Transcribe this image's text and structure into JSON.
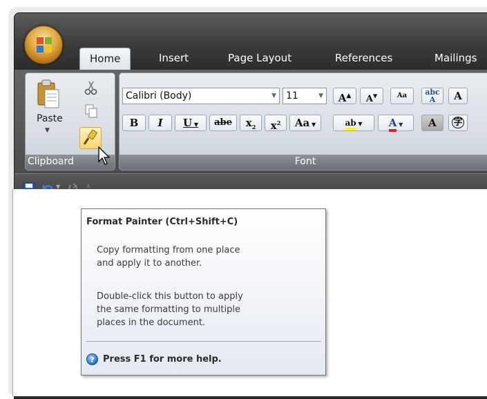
{
  "ribbon": {
    "tabs": [
      {
        "label": "Home"
      },
      {
        "label": "Insert"
      },
      {
        "label": "Page Layout"
      },
      {
        "label": "References"
      },
      {
        "label": "Mailings"
      }
    ],
    "clipboard": {
      "paste_label": "Paste",
      "group_label": "Clipboard"
    },
    "font": {
      "font_name": "Calibri (Body)",
      "font_size": "11",
      "group_label": "Font",
      "bold": "B",
      "italic": "I",
      "underline": "U",
      "strike": "abe",
      "subscript": "x",
      "superscript": "x",
      "change_case": "Aa",
      "highlight": "ab",
      "font_color": "A",
      "char_shading": "A",
      "enclose": "字"
    }
  },
  "tooltip": {
    "title": "Format Painter (Ctrl+Shift+C)",
    "line1": "Copy formatting from one place",
    "line2": "and apply it to another.",
    "line3": "Double-click this button to apply",
    "line4": "the same formatting to multiple",
    "line5": "places in the document.",
    "help": "Press F1 for more help."
  },
  "colors": {
    "accent": "#1f6fd1",
    "highlight": "#ffff00",
    "font_color": "#e02020"
  }
}
